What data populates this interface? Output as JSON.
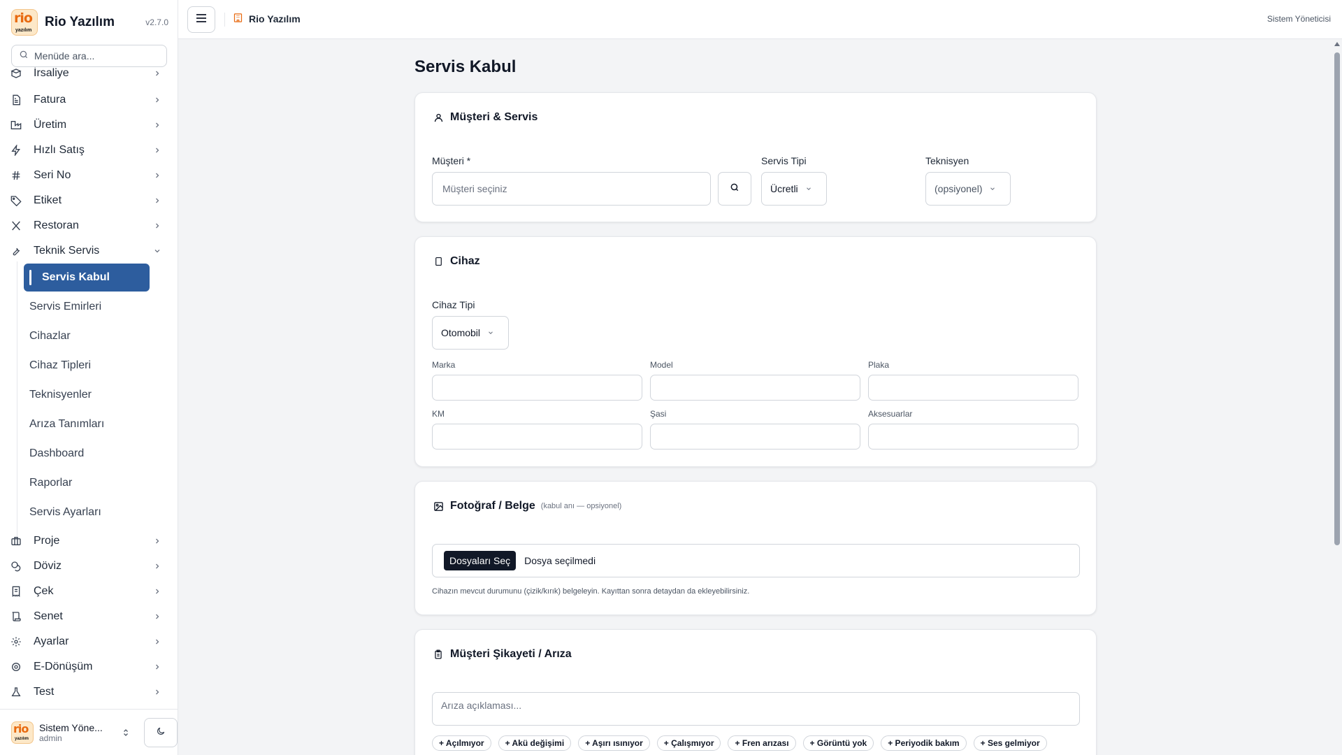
{
  "app": {
    "name": "Rio Yazılım",
    "version": "v2.7.0",
    "logo_text": "rio",
    "logo_sub": "yazılım"
  },
  "sidebar": {
    "search_placeholder": "Menüde ara...",
    "items": [
      {
        "label": "İrsaliye",
        "icon": "box-icon"
      },
      {
        "label": "Fatura",
        "icon": "document-icon"
      },
      {
        "label": "Üretim",
        "icon": "factory-icon"
      },
      {
        "label": "Hızlı Satış",
        "icon": "bolt-icon"
      },
      {
        "label": "Seri No",
        "icon": "hash-icon"
      },
      {
        "label": "Etiket",
        "icon": "tag-icon"
      },
      {
        "label": "Restoran",
        "icon": "utensils-icon"
      },
      {
        "label": "Teknik Servis",
        "icon": "wrench-icon",
        "expanded": true
      },
      {
        "label": "Proje",
        "icon": "briefcase-icon"
      },
      {
        "label": "Döviz",
        "icon": "coins-icon"
      },
      {
        "label": "Çek",
        "icon": "receipt-icon"
      },
      {
        "label": "Senet",
        "icon": "scroll-icon"
      },
      {
        "label": "Ayarlar",
        "icon": "gear-icon"
      },
      {
        "label": "E-Dönüşüm",
        "icon": "gear-icon"
      },
      {
        "label": "Test",
        "icon": "flask-icon"
      }
    ],
    "sub_items": [
      {
        "label": "Servis Kabul",
        "active": true
      },
      {
        "label": "Servis Emirleri"
      },
      {
        "label": "Cihazlar"
      },
      {
        "label": "Cihaz Tipleri"
      },
      {
        "label": "Teknisyenler"
      },
      {
        "label": "Arıza Tanımları"
      },
      {
        "label": "Dashboard"
      },
      {
        "label": "Raporlar"
      },
      {
        "label": "Servis Ayarları"
      }
    ],
    "user": {
      "name": "Sistem Yöne...",
      "role": "admin"
    }
  },
  "topbar": {
    "title": "Rio Yazılım",
    "user": "Sistem Yöneticisi"
  },
  "page": {
    "title": "Servis Kabul"
  },
  "customer_section": {
    "title": "Müşteri & Servis",
    "customer_label": "Müşteri *",
    "customer_placeholder": "Müşteri seçiniz",
    "service_type_label": "Servis Tipi",
    "service_type_value": "Ücretli",
    "technician_label": "Teknisyen",
    "technician_value": "(opsiyonel)"
  },
  "device_section": {
    "title": "Cihaz",
    "device_type_label": "Cihaz Tipi",
    "device_type_value": "Otomobil",
    "fields": {
      "marka": "Marka",
      "model": "Model",
      "plaka": "Plaka",
      "km": "KM",
      "sasi": "Şasi",
      "aksesuar": "Aksesuarlar"
    }
  },
  "photo_section": {
    "title": "Fotoğraf / Belge",
    "note": "(kabul anı — opsiyonel)",
    "choose_button": "Dosyaları Seç",
    "file_status": "Dosya seçilmedi",
    "hint": "Cihazın mevcut durumunu (çizik/kırık) belgeleyin. Kayıttan sonra detaydan da ekleyebilirsiniz."
  },
  "complaint_section": {
    "title": "Müşteri Şikayeti / Arıza",
    "placeholder": "Arıza açıklaması...",
    "chips": [
      "+ Açılmıyor",
      "+ Akü değişimi",
      "+ Aşırı ısınıyor",
      "+ Çalışmıyor",
      "+ Fren arızası",
      "+ Görüntü yok",
      "+ Periyodik bakım",
      "+ Ses gelmiyor"
    ]
  },
  "colors": {
    "accent": "#2d5d9e",
    "brand": "#e86a10"
  }
}
